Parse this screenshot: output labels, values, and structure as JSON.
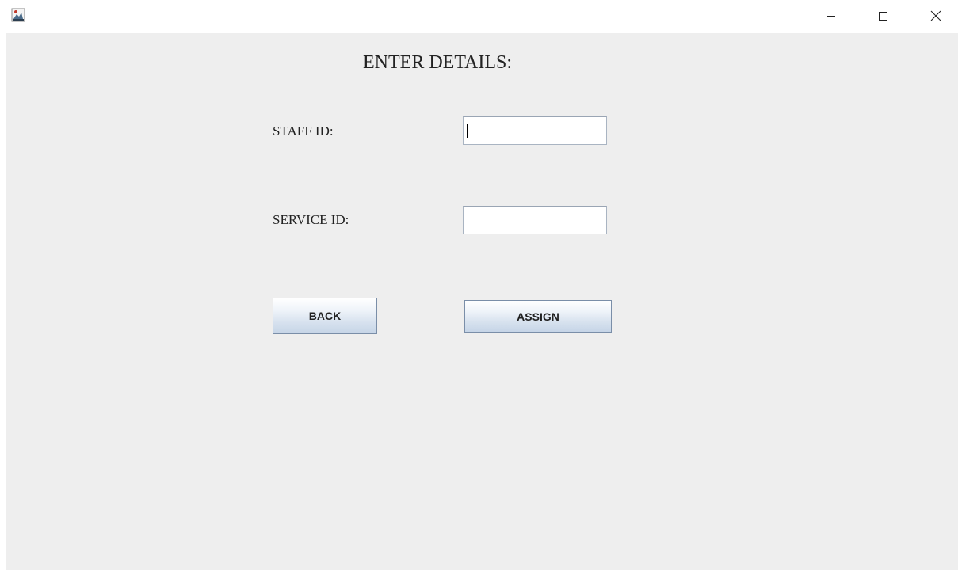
{
  "titlebar": {
    "app_icon": "java-app-icon",
    "controls": {
      "minimize": "minimize-icon",
      "maximize": "maximize-icon",
      "close": "close-icon"
    }
  },
  "form": {
    "heading": "ENTER DETAILS:",
    "staff_id_label": "STAFF ID:",
    "staff_id_value": "",
    "service_id_label": "SERVICE ID:",
    "service_id_value": "",
    "back_label": "BACK",
    "assign_label": "ASSIGN"
  },
  "colors": {
    "panel_background": "#eeeeee",
    "titlebar_background": "#ffffff",
    "button_border": "#7a8ea8",
    "field_border": "#a9b4c2"
  }
}
